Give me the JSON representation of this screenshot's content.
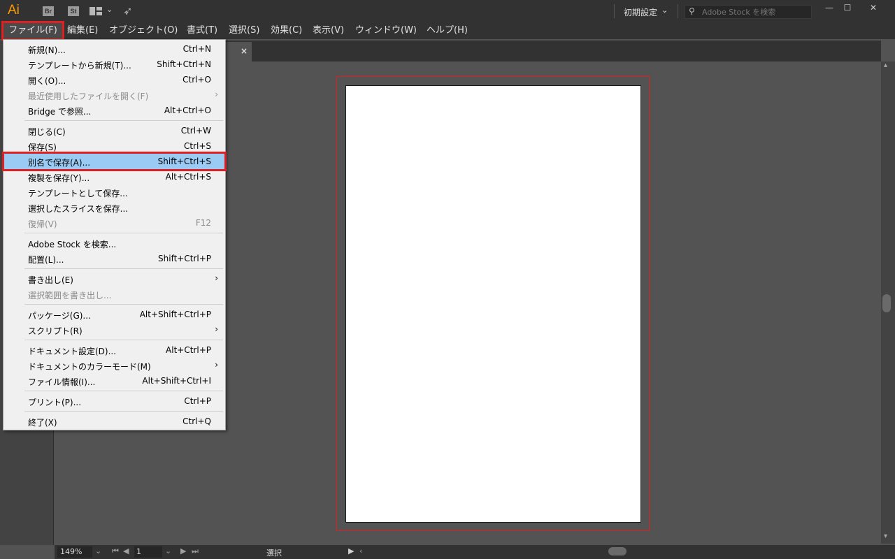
{
  "titlebar": {
    "logo": "Ai",
    "bridge_icon": "Br",
    "stock_icon": "St",
    "workspace": "初期設定",
    "search_placeholder": "Adobe Stock を検索",
    "minimize": "—",
    "maximize": "☐",
    "close": "✕"
  },
  "menubar": {
    "items": [
      {
        "label": "ファイル(F)"
      },
      {
        "label": "編集(E)"
      },
      {
        "label": "オブジェクト(O)"
      },
      {
        "label": "書式(T)"
      },
      {
        "label": "選択(S)"
      },
      {
        "label": "効果(C)"
      },
      {
        "label": "表示(V)"
      },
      {
        "label": "ウィンドウ(W)"
      },
      {
        "label": "ヘルプ(H)"
      }
    ]
  },
  "tab": {
    "label_fragment": ")",
    "close": "×"
  },
  "file_menu": {
    "items": [
      {
        "label": "新規(N)...",
        "shortcut": "Ctrl+N"
      },
      {
        "label": "テンプレートから新規(T)...",
        "shortcut": "Shift+Ctrl+N"
      },
      {
        "label": "開く(O)...",
        "shortcut": "Ctrl+O"
      },
      {
        "label": "最近使用したファイルを開く(F)",
        "submenu": "›",
        "disabled": true
      },
      {
        "label": "Bridge で参照...",
        "shortcut": "Alt+Ctrl+O"
      },
      {
        "label": "閉じる(C)",
        "shortcut": "Ctrl+W"
      },
      {
        "label": "保存(S)",
        "shortcut": "Ctrl+S"
      },
      {
        "label": "別名で保存(A)...",
        "shortcut": "Shift+Ctrl+S",
        "selected": true
      },
      {
        "label": "複製を保存(Y)...",
        "shortcut": "Alt+Ctrl+S"
      },
      {
        "label": "テンプレートとして保存..."
      },
      {
        "label": "選択したスライスを保存..."
      },
      {
        "label": "復帰(V)",
        "shortcut": "F12",
        "disabled": true
      },
      {
        "label": "Adobe Stock を検索..."
      },
      {
        "label": "配置(L)...",
        "shortcut": "Shift+Ctrl+P"
      },
      {
        "label": "書き出し(E)",
        "submenu": "›"
      },
      {
        "label": "選択範囲を書き出し...",
        "disabled": true
      },
      {
        "label": "パッケージ(G)...",
        "shortcut": "Alt+Shift+Ctrl+P"
      },
      {
        "label": "スクリプト(R)",
        "submenu": "›"
      },
      {
        "label": "ドキュメント設定(D)...",
        "shortcut": "Alt+Ctrl+P"
      },
      {
        "label": "ドキュメントのカラーモード(M)",
        "submenu": "›"
      },
      {
        "label": "ファイル情報(I)...",
        "shortcut": "Alt+Shift+Ctrl+I"
      },
      {
        "label": "プリント(P)...",
        "shortcut": "Ctrl+P"
      },
      {
        "label": "終了(X)",
        "shortcut": "Ctrl+Q"
      }
    ]
  },
  "statusbar": {
    "zoom": "149%",
    "page": "1",
    "status": "選択"
  },
  "colors": {
    "highlight": "#e02020",
    "selected_item": "#99cbf4",
    "logo": "#ff9a00"
  }
}
